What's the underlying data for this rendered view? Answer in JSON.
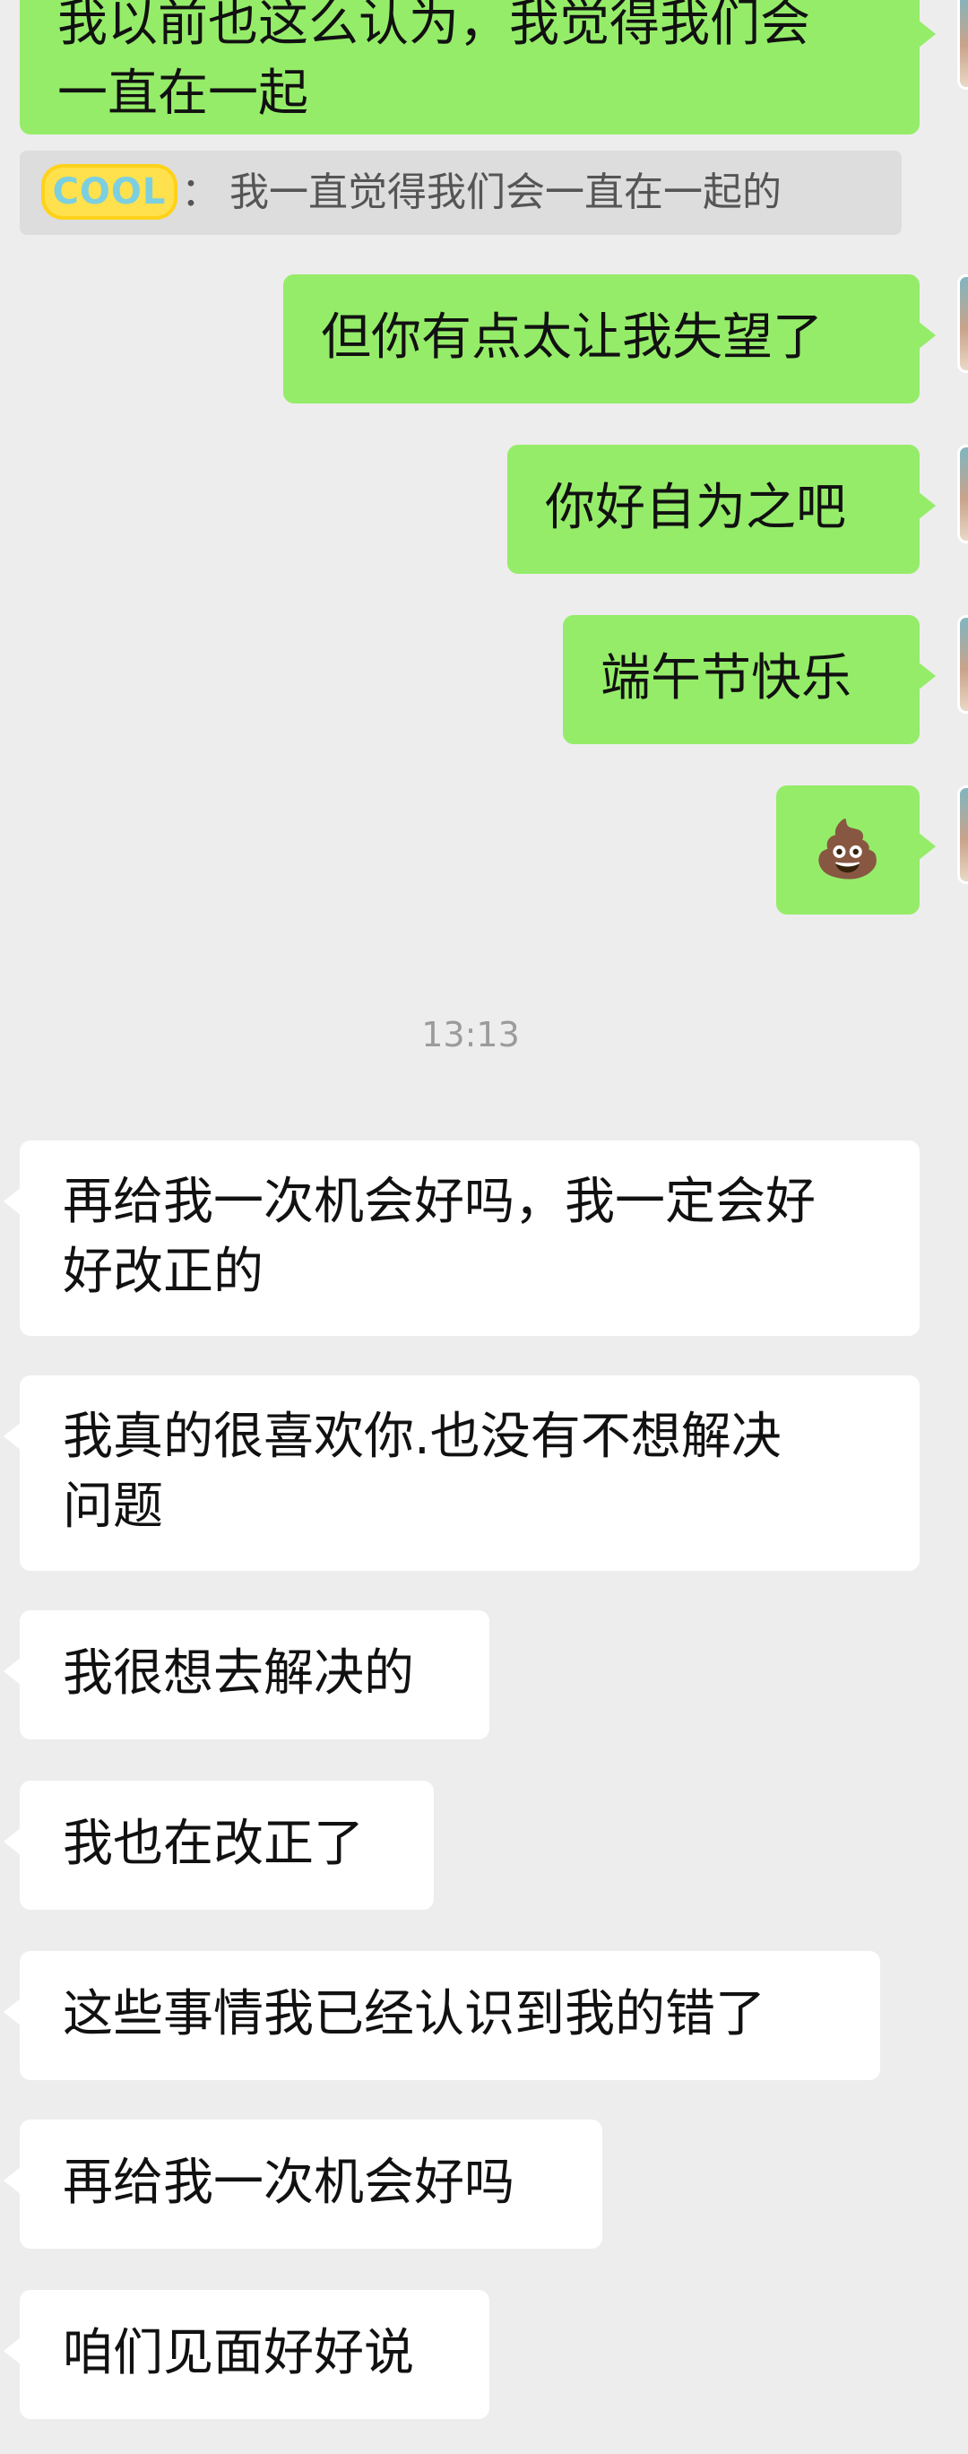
{
  "messages_top": {
    "partial_sent_line1": "我以前也这么认为，我觉得我们会",
    "partial_sent_line2": "一直在一起"
  },
  "quote": {
    "sender_badge": "COOL",
    "separator": "：",
    "text": "我一直觉得我们会一直在一起的"
  },
  "sent_messages": [
    "但你有点太让我失望了",
    "你好自为之吧",
    "端午节快乐",
    "💩"
  ],
  "timestamp": "13:13",
  "received_messages": [
    [
      "再给我一次机会好吗，我一定会好",
      "好改正的"
    ],
    [
      "我真的很喜欢你.也没有不想解决",
      "问题"
    ],
    [
      "我很想去解决的"
    ],
    [
      "我也在改正了"
    ],
    [
      "这些事情我已经认识到我的错了"
    ],
    [
      "再给我一次机会好吗"
    ],
    [
      "咱们见面好好说"
    ]
  ]
}
